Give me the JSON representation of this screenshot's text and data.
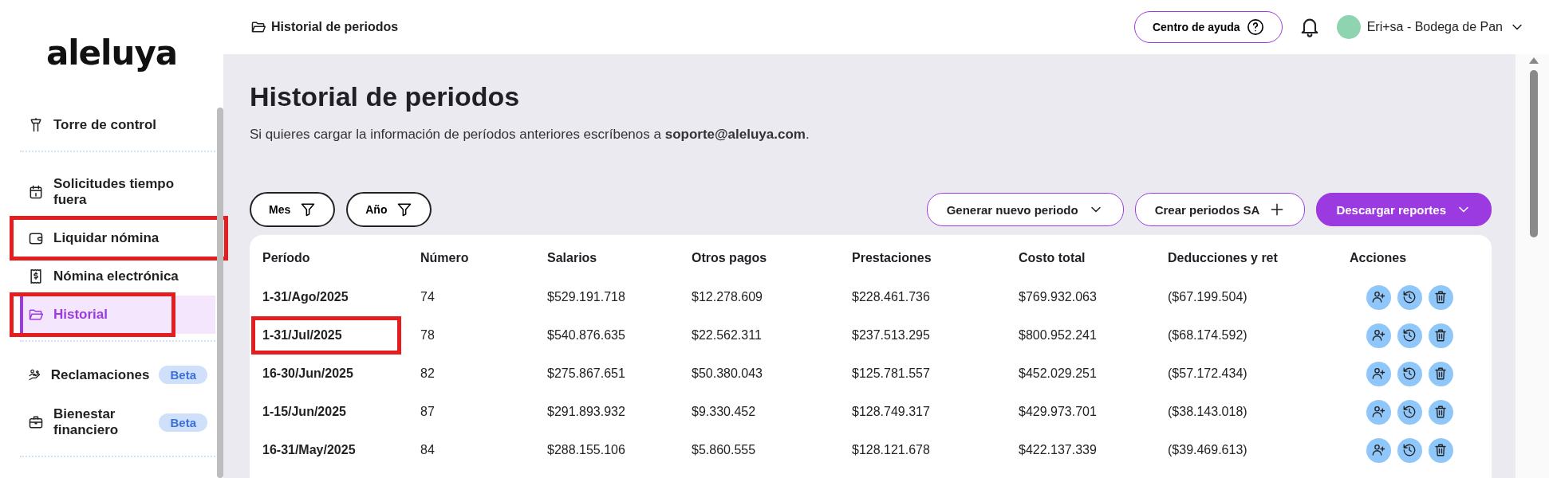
{
  "sidebar": {
    "logo": "aleluya",
    "groups": [
      {
        "items": [
          {
            "label": "Torre de control",
            "selected": false,
            "annotated": false
          }
        ]
      },
      {
        "items": [
          {
            "label": "Solicitudes tiempo fuera",
            "selected": false,
            "annotated": false
          },
          {
            "label": "Liquidar nómina",
            "selected": false,
            "annotated": true
          },
          {
            "label": "Nómina electrónica",
            "selected": false,
            "annotated": false
          },
          {
            "label": "Historial",
            "selected": true,
            "annotated": true
          }
        ]
      },
      {
        "items": [
          {
            "label": "Reclamaciones",
            "selected": false,
            "annotated": false,
            "badge": "Beta"
          },
          {
            "label": "Bienestar financiero",
            "selected": false,
            "annotated": false,
            "badge": "Beta"
          }
        ]
      }
    ]
  },
  "header": {
    "breadcrumb": "Historial de periodos",
    "help_button": "Centro de ayuda",
    "account": "Eri+sa - Bodega de Pan"
  },
  "page": {
    "title": "Historial de periodos",
    "subtitle": "Si quieres cargar la información de períodos anteriores escríbenos a **soporte@aleluya.com**.",
    "filters": [
      "Mes",
      "Año"
    ],
    "actions": [
      {
        "label": "Generar nuevo periodo",
        "kind": "dropdown",
        "primary": false
      },
      {
        "label": "Crear periodos SA",
        "kind": "add",
        "primary": false
      },
      {
        "label": "Descargar reportes",
        "kind": "dropdown",
        "primary": true
      }
    ]
  },
  "table": {
    "columns": [
      "Período",
      "Número",
      "Salarios",
      "Otros pagos",
      "Prestaciones",
      "Costo total",
      "Deducciones y ret",
      "Acciones"
    ],
    "rows": [
      {
        "cells": [
          "1-31/Ago/2025",
          "74",
          "$529.191.718",
          "$12.278.609",
          "$228.461.736",
          "$769.932.063",
          "($67.199.504)"
        ],
        "annotated": false
      },
      {
        "cells": [
          "1-31/Jul/2025",
          "78",
          "$540.876.635",
          "$22.562.311",
          "$237.513.295",
          "$800.952.241",
          "($68.174.592)"
        ],
        "annotated": true
      },
      {
        "cells": [
          "16-30/Jun/2025",
          "82",
          "$275.867.651",
          "$50.380.043",
          "$125.781.557",
          "$452.029.251",
          "($57.172.434)"
        ],
        "annotated": false
      },
      {
        "cells": [
          "1-15/Jun/2025",
          "87",
          "$291.893.932",
          "$9.330.452",
          "$128.749.317",
          "$429.973.701",
          "($38.143.018)"
        ],
        "annotated": false
      },
      {
        "cells": [
          "16-31/May/2025",
          "84",
          "$288.155.106",
          "$5.860.555",
          "$128.121.678",
          "$422.137.339",
          "($39.469.613)"
        ],
        "annotated": false
      }
    ]
  }
}
